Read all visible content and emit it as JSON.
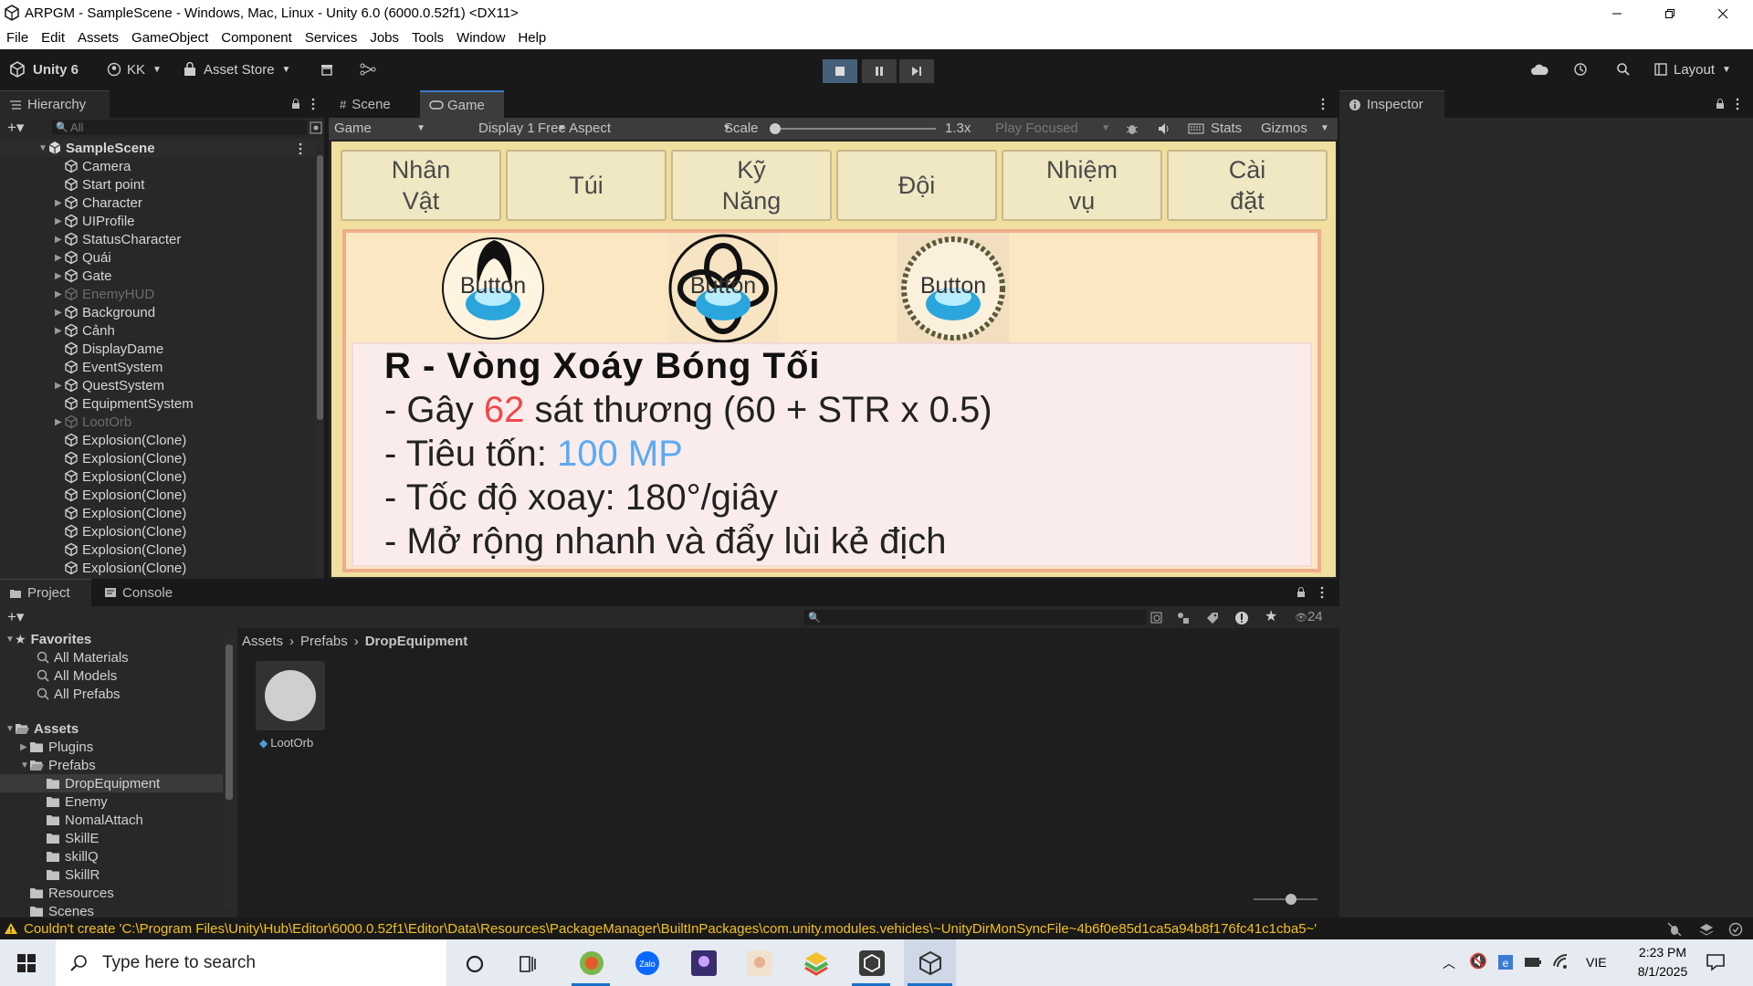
{
  "window": {
    "title": "ARPGM - SampleScene - Windows, Mac, Linux - Unity 6.0 (6000.0.52f1) <DX11>"
  },
  "menu": [
    "File",
    "Edit",
    "Assets",
    "GameObject",
    "Component",
    "Services",
    "Jobs",
    "Tools",
    "Window",
    "Help"
  ],
  "toolbar": {
    "unity_label": "Unity 6",
    "account": "KK",
    "asset_store": "Asset Store",
    "layout": "Layout"
  },
  "hierarchy": {
    "tab": "Hierarchy",
    "search_placeholder": "All",
    "scene": "SampleScene",
    "items": [
      {
        "label": "Camera",
        "expandable": false,
        "dim": false
      },
      {
        "label": "Start point",
        "expandable": false,
        "dim": false
      },
      {
        "label": "Character",
        "expandable": true,
        "dim": false
      },
      {
        "label": "UIProfile",
        "expandable": true,
        "dim": false
      },
      {
        "label": "StatusCharacter",
        "expandable": true,
        "dim": false
      },
      {
        "label": "Quái",
        "expandable": true,
        "dim": false
      },
      {
        "label": "Gate",
        "expandable": true,
        "dim": false
      },
      {
        "label": "EnemyHUD",
        "expandable": true,
        "dim": true
      },
      {
        "label": "Background",
        "expandable": true,
        "dim": false
      },
      {
        "label": "Cảnh",
        "expandable": true,
        "dim": false
      },
      {
        "label": "DisplayDame",
        "expandable": false,
        "dim": false
      },
      {
        "label": "EventSystem",
        "expandable": false,
        "dim": false
      },
      {
        "label": "QuestSystem",
        "expandable": true,
        "dim": false
      },
      {
        "label": "EquipmentSystem",
        "expandable": false,
        "dim": false
      },
      {
        "label": "LootOrb",
        "expandable": true,
        "dim": true
      },
      {
        "label": "Explosion(Clone)",
        "expandable": false,
        "dim": false
      },
      {
        "label": "Explosion(Clone)",
        "expandable": false,
        "dim": false
      },
      {
        "label": "Explosion(Clone)",
        "expandable": false,
        "dim": false
      },
      {
        "label": "Explosion(Clone)",
        "expandable": false,
        "dim": false
      },
      {
        "label": "Explosion(Clone)",
        "expandable": false,
        "dim": false
      },
      {
        "label": "Explosion(Clone)",
        "expandable": false,
        "dim": false
      },
      {
        "label": "Explosion(Clone)",
        "expandable": false,
        "dim": false
      },
      {
        "label": "Explosion(Clone)",
        "expandable": false,
        "dim": false
      }
    ]
  },
  "center_tabs": {
    "scene": "Scene",
    "game": "Game"
  },
  "game_toolbar": {
    "mode": "Game",
    "display": "Display 1",
    "aspect": "Free Aspect",
    "scale_label": "Scale",
    "scale_value": "1.3x",
    "play_focused": "Play Focused",
    "stats": "Stats",
    "gizmos": "Gizmos"
  },
  "game": {
    "tabs": [
      "Nhân\nVật",
      "Túi",
      "Kỹ\nNăng",
      "Đội",
      "Nhiệm\nvụ",
      "Cài\nđặt"
    ],
    "skill_buttons": [
      "Button",
      "Button",
      "Button"
    ],
    "skill": {
      "title": "R - Vòng Xoáy Bóng Tối",
      "line1_pre": "- Gây ",
      "line1_val": "62",
      "line1_post": " sát thương (60 + STR x 0.5)",
      "line2_pre": "- Tiêu tốn: ",
      "line2_val": "100 MP",
      "line3": "- Tốc độ xoay: 180°/giây",
      "line4": "- Mở rộng nhanh và đẩy lùi kẻ địch"
    },
    "colors": {
      "damage": "#f04848",
      "mana": "#5aaaf5"
    }
  },
  "inspector": {
    "tab": "Inspector"
  },
  "project": {
    "tab_project": "Project",
    "tab_console": "Console",
    "count": "24",
    "breadcrumb": [
      "Assets",
      "Prefabs",
      "DropEquipment"
    ],
    "favorites_label": "Favorites",
    "favorites": [
      "All Materials",
      "All Models",
      "All Prefabs"
    ],
    "assets_label": "Assets",
    "tree": [
      {
        "label": "Plugins",
        "indent": 1,
        "expandable": true,
        "open": false
      },
      {
        "label": "Prefabs",
        "indent": 1,
        "expandable": true,
        "open": true
      },
      {
        "label": "DropEquipment",
        "indent": 2,
        "expandable": false,
        "open": false
      },
      {
        "label": "Enemy",
        "indent": 2,
        "expandable": false,
        "open": false
      },
      {
        "label": "NomalAttach",
        "indent": 2,
        "expandable": false,
        "open": false
      },
      {
        "label": "SkillE",
        "indent": 2,
        "expandable": false,
        "open": false
      },
      {
        "label": "skillQ",
        "indent": 2,
        "expandable": false,
        "open": false
      },
      {
        "label": "SkillR",
        "indent": 2,
        "expandable": false,
        "open": false
      },
      {
        "label": "Resources",
        "indent": 1,
        "expandable": false,
        "open": false
      },
      {
        "label": "Scenes",
        "indent": 1,
        "expandable": false,
        "open": false
      }
    ],
    "asset": "LootOrb"
  },
  "status": {
    "message": "Couldn't create 'C:\\Program Files\\Unity\\Hub\\Editor\\6000.0.52f1\\Editor\\Data\\Resources\\PackageManager\\BuiltInPackages\\com.unity.modules.vehicles\\~UnityDirMonSyncFile~4b6f0e85d1ca5a94b8f176fc41c1cba5~'"
  },
  "taskbar": {
    "search_placeholder": "Type here to search",
    "lang": "VIE",
    "time": "2:23 PM",
    "date": "8/1/2025"
  }
}
